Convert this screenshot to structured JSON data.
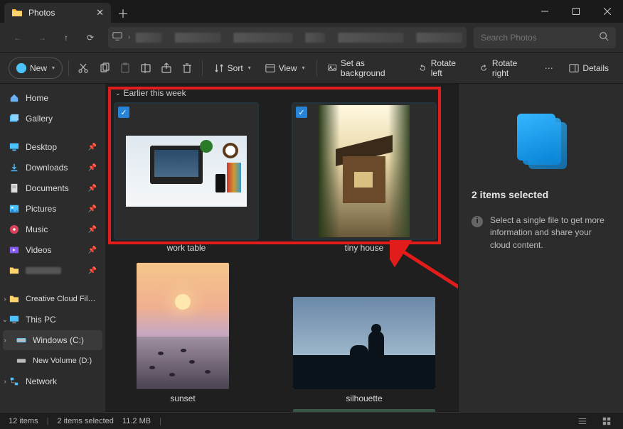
{
  "titlebar": {
    "tab_title": "Photos"
  },
  "search": {
    "placeholder": "Search Photos"
  },
  "toolbar": {
    "new": "New",
    "sort": "Sort",
    "view": "View",
    "bg": "Set as background",
    "rotl": "Rotate left",
    "rotr": "Rotate right",
    "details": "Details"
  },
  "sidebar": {
    "home": "Home",
    "gallery": "Gallery",
    "desktop": "Desktop",
    "downloads": "Downloads",
    "documents": "Documents",
    "pictures": "Pictures",
    "music": "Music",
    "videos": "Videos",
    "ccf": "Creative Cloud Fil…",
    "thispc": "This PC",
    "winc": "Windows (C:)",
    "newvol": "New Volume (D:)",
    "network": "Network"
  },
  "content": {
    "group": "Earlier this week",
    "items": [
      {
        "caption": "work table"
      },
      {
        "caption": "tiny house"
      },
      {
        "caption": "sunset"
      },
      {
        "caption": "silhouette"
      }
    ]
  },
  "details": {
    "title": "2 items selected",
    "info": "Select a single file to get more information and share your cloud content."
  },
  "status": {
    "count": "12 items",
    "sel": "2 items selected",
    "size": "11.2 MB"
  }
}
